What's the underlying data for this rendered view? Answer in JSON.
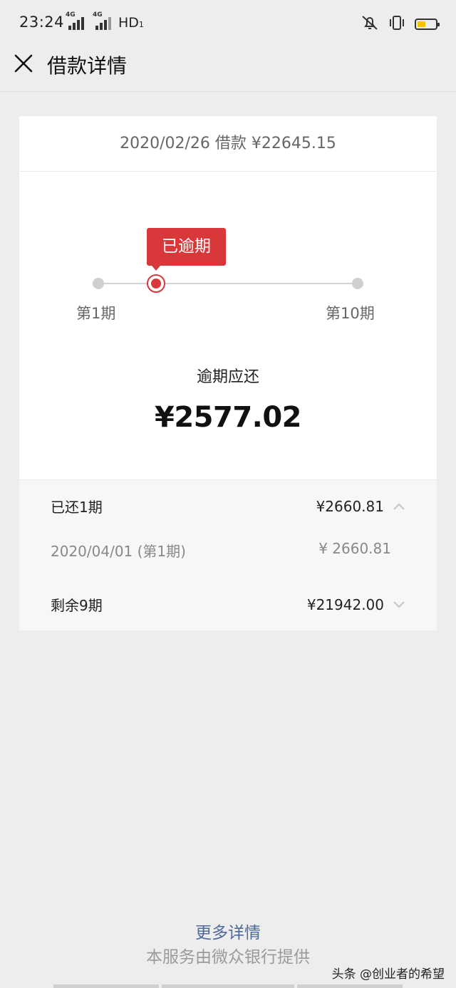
{
  "status_bar": {
    "time": "23:24",
    "network_1": "4G",
    "network_2": "4G",
    "hd": "HD",
    "hd_sub": "1",
    "battery_level_percent": 45
  },
  "header": {
    "title": "借款详情"
  },
  "loan": {
    "summary": "2020/02/26 借款 ¥22645.15"
  },
  "timeline": {
    "badge": "已逾期",
    "start_label": "第1期",
    "end_label": "第10期",
    "current_period": 1,
    "total_periods": 10
  },
  "due": {
    "label": "逾期应还",
    "amount": "¥2577.02"
  },
  "repaid": {
    "label": "已还1期",
    "amount": "¥2660.81",
    "items": [
      {
        "date": "2020/04/01 (第1期)",
        "amount": "¥ 2660.81"
      }
    ]
  },
  "remaining": {
    "label": "剩余9期",
    "amount": "¥21942.00"
  },
  "footer": {
    "more_link": "更多详情",
    "provider": "本服务由微众银行提供",
    "watermark": "头条 @创业者的希望"
  },
  "colors": {
    "accent_red": "#d9383a",
    "link_blue": "#4d6a9a",
    "battery": "#f5c400"
  }
}
